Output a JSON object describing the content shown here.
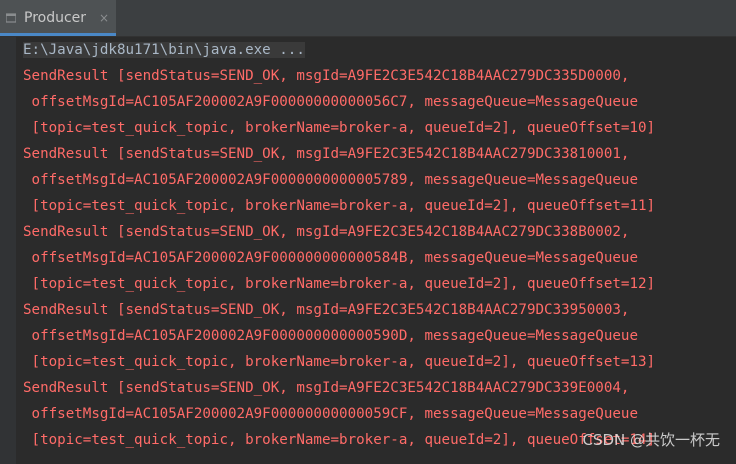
{
  "tab": {
    "label": "Producer",
    "close": "×",
    "icon": "console-icon"
  },
  "console": {
    "command": "E:\\Java\\jdk8u171\\bin\\java.exe ...",
    "lines": [
      "SendResult [sendStatus=SEND_OK, msgId=A9FE2C3E542C18B4AAC279DC335D0000,",
      " offsetMsgId=AC105AF200002A9F00000000000056C7, messageQueue=MessageQueue",
      " [topic=test_quick_topic, brokerName=broker-a, queueId=2], queueOffset=10]",
      "SendResult [sendStatus=SEND_OK, msgId=A9FE2C3E542C18B4AAC279DC33810001,",
      " offsetMsgId=AC105AF200002A9F0000000000005789, messageQueue=MessageQueue",
      " [topic=test_quick_topic, brokerName=broker-a, queueId=2], queueOffset=11]",
      "SendResult [sendStatus=SEND_OK, msgId=A9FE2C3E542C18B4AAC279DC338B0002,",
      " offsetMsgId=AC105AF200002A9F000000000000584B, messageQueue=MessageQueue",
      " [topic=test_quick_topic, brokerName=broker-a, queueId=2], queueOffset=12]",
      "SendResult [sendStatus=SEND_OK, msgId=A9FE2C3E542C18B4AAC279DC33950003,",
      " offsetMsgId=AC105AF200002A9F000000000000590D, messageQueue=MessageQueue",
      " [topic=test_quick_topic, brokerName=broker-a, queueId=2], queueOffset=13]",
      "SendResult [sendStatus=SEND_OK, msgId=A9FE2C3E542C18B4AAC279DC339E0004,",
      " offsetMsgId=AC105AF200002A9F00000000000059CF, messageQueue=MessageQueue",
      " [topic=test_quick_topic, brokerName=broker-a, queueId=2], queueOffset=14]"
    ]
  },
  "watermark": "CSDN @共饮一杯无",
  "colors": {
    "error_text": "#ff6b68",
    "command_text": "#a9b7c6",
    "background": "#2b2b2b",
    "tab_background": "#4e5254",
    "tab_accent": "#4a88c7"
  }
}
